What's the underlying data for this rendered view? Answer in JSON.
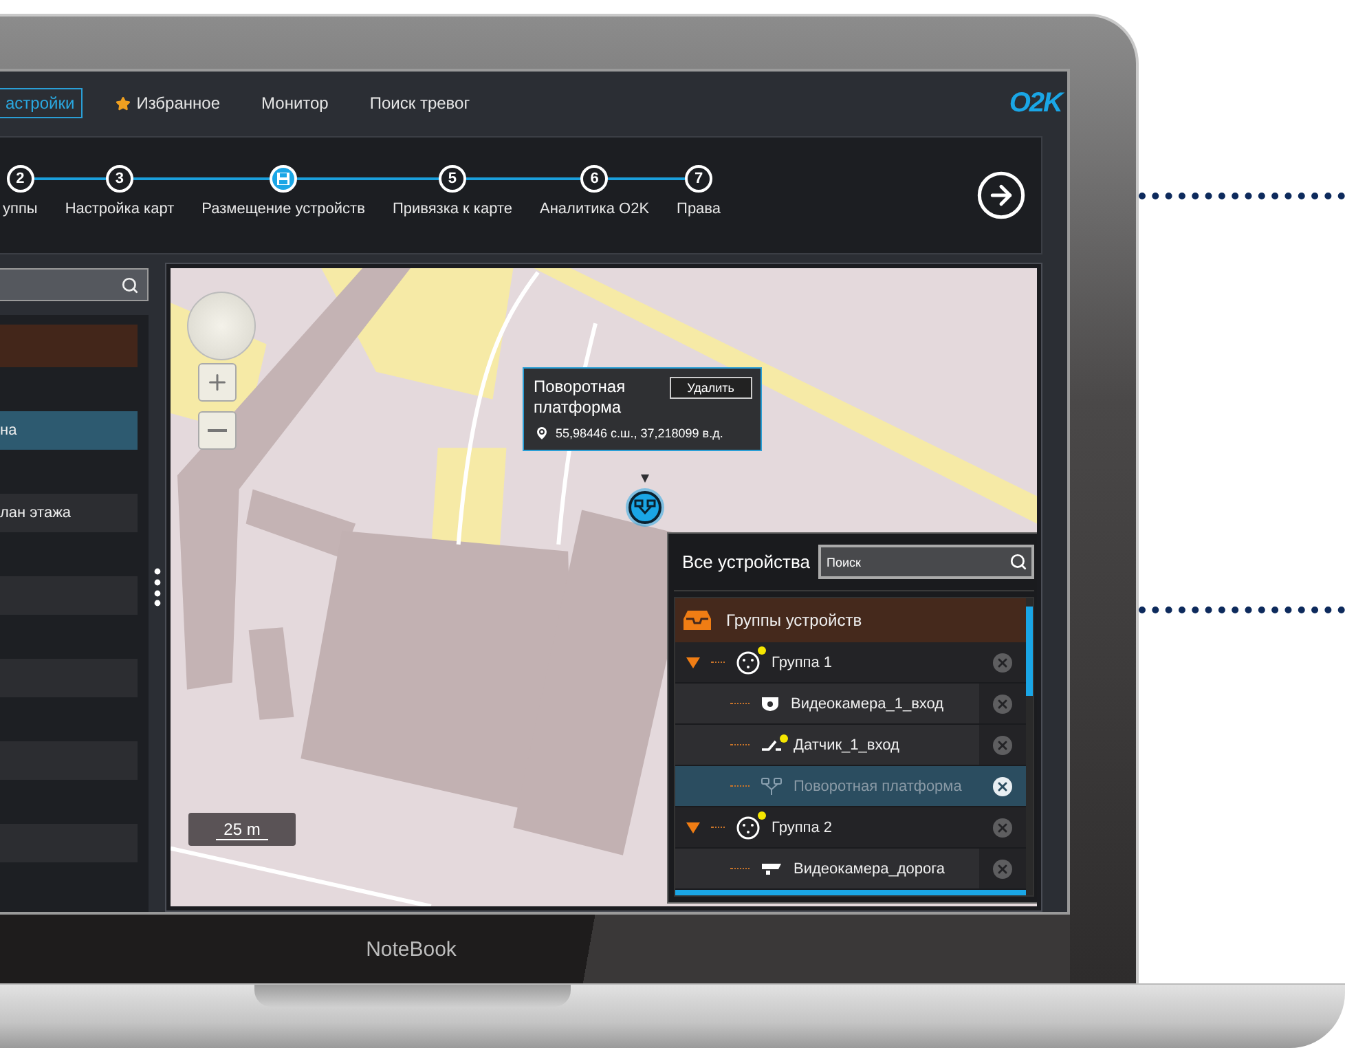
{
  "nav": {
    "tabs": [
      {
        "label": "астройки",
        "selected": true,
        "starred": false
      },
      {
        "label": "Избранное",
        "selected": false,
        "starred": true
      },
      {
        "label": "Монитор",
        "selected": false,
        "starred": false
      },
      {
        "label": "Поиск тревог",
        "selected": false,
        "starred": false
      }
    ],
    "logo": "O2K"
  },
  "stepper": {
    "steps": [
      {
        "number": "2",
        "label": "уппы",
        "selected": false
      },
      {
        "number": "3",
        "label": "Настройка карт",
        "selected": false
      },
      {
        "label": "Размещение устройств",
        "selected": true
      },
      {
        "number": "5",
        "label": "Привязка к карте",
        "selected": false
      },
      {
        "number": "6",
        "label": "Аналитика O2K",
        "selected": false
      },
      {
        "number": "7",
        "label": "Права",
        "selected": false
      }
    ]
  },
  "sidebar": {
    "items": [
      {
        "kind": "header",
        "selected": false
      },
      {
        "kind": "row",
        "label": "на",
        "selected": true
      },
      {
        "kind": "row",
        "label": "лан этажа",
        "selected": false
      },
      {
        "kind": "row",
        "selected": false
      },
      {
        "kind": "row",
        "selected": false
      },
      {
        "kind": "row",
        "selected": false
      },
      {
        "kind": "row",
        "selected": false
      }
    ]
  },
  "map": {
    "scale": "25 m",
    "popup": {
      "title": "Поворотная платформа",
      "delete_button": "Удалить",
      "coordinates": "55,98446 с.ш., 37,218099 в.д."
    },
    "devices_panel": {
      "title": "Все устройства",
      "search_placeholder": "Поиск",
      "tree": {
        "label": "Группы устройств",
        "children": [
          {
            "label": "Группа 1",
            "expanded": true,
            "alert": true,
            "children": [
              {
                "kind": "dome-camera",
                "label": "Видеокамера_1_вход",
                "alert": false,
                "selected": false
              },
              {
                "kind": "switch",
                "label": "Датчик_1_вход",
                "alert": true,
                "selected": false
              },
              {
                "kind": "turntable",
                "label": "Поворотная платформа",
                "alert": false,
                "selected": true
              }
            ]
          },
          {
            "label": "Группа 2",
            "expanded": true,
            "alert": true,
            "children": [
              {
                "kind": "bullet-camera",
                "label": "Видеокамера_дорога",
                "alert": false,
                "selected": false
              }
            ]
          }
        ]
      }
    }
  },
  "laptop": {
    "brand": "NoteBook"
  }
}
